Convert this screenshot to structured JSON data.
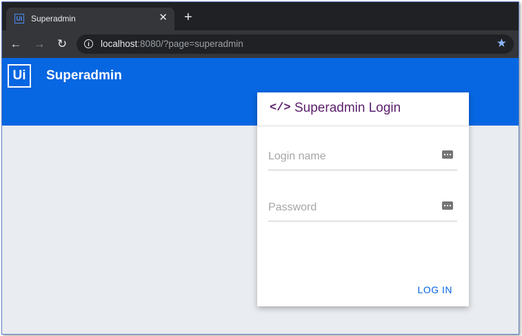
{
  "browser": {
    "tab_title": "Superadmin",
    "tab_favicon_text": "Ui",
    "close_glyph": "✕",
    "new_tab_glyph": "+",
    "url_host": "localhost",
    "url_rest": ":8080/?page=superadmin",
    "icons": [
      "back-arrow-icon",
      "forward-arrow-icon",
      "reload-icon",
      "info-icon",
      "star-icon"
    ]
  },
  "app": {
    "logo_text": "Ui",
    "title": "Superadmin",
    "brand_color": "#0766e1"
  },
  "login_card": {
    "icon_text": "</>",
    "title": "Superadmin Login",
    "title_color": "#5a1f6b",
    "login_name_placeholder": "Login name",
    "password_placeholder": "Password",
    "submit_label": "LOG IN"
  }
}
